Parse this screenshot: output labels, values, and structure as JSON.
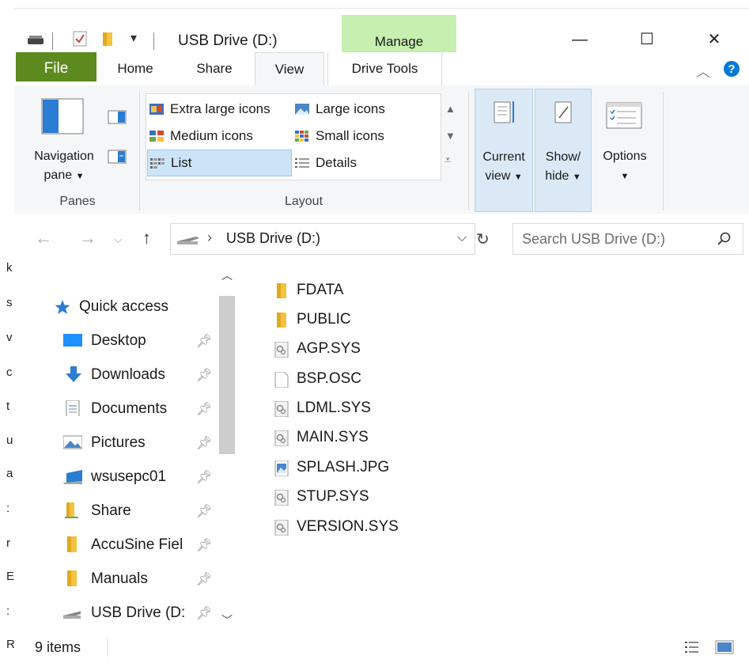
{
  "window": {
    "title": "USB Drive (D:)",
    "context_tab": "Manage",
    "controls": {
      "minimize": "—",
      "maximize": "☐",
      "close": "✕"
    }
  },
  "ribbon_tabs": [
    {
      "label": "File"
    },
    {
      "label": "Home"
    },
    {
      "label": "Share"
    },
    {
      "label": "View"
    },
    {
      "label": "Drive Tools"
    }
  ],
  "ribbon": {
    "panes": {
      "group_label": "Panes",
      "nav_pane_line1": "Navigation",
      "nav_pane_line2": "pane"
    },
    "layout": {
      "group_label": "Layout",
      "options": [
        {
          "label": "Extra large icons"
        },
        {
          "label": "Large icons"
        },
        {
          "label": "Medium icons"
        },
        {
          "label": "Small icons"
        },
        {
          "label": "List",
          "selected": true
        },
        {
          "label": "Details"
        }
      ]
    },
    "current_view": {
      "line1": "Current",
      "line2": "view"
    },
    "show_hide": {
      "line1": "Show/",
      "line2": "hide"
    },
    "options": {
      "label": "Options"
    }
  },
  "address": {
    "breadcrumb": "USB Drive (D:)",
    "search_placeholder": "Search USB Drive (D:)"
  },
  "nav_pane": {
    "quick_access": "Quick access",
    "items": [
      {
        "label": "Desktop",
        "icon": "desktop-icon"
      },
      {
        "label": "Downloads",
        "icon": "downloads-icon"
      },
      {
        "label": "Documents",
        "icon": "documents-icon"
      },
      {
        "label": "Pictures",
        "icon": "pictures-icon"
      },
      {
        "label": "wsusepc01",
        "icon": "network-computer-icon"
      },
      {
        "label": "Share",
        "icon": "share-folder-icon"
      },
      {
        "label": "AccuSine Fiel",
        "icon": "folder-icon"
      },
      {
        "label": "Manuals",
        "icon": "folder-icon"
      },
      {
        "label": "USB Drive (D:",
        "icon": "usb-drive-icon"
      }
    ]
  },
  "files": [
    {
      "name": "FDATA",
      "type": "folder"
    },
    {
      "name": "PUBLIC",
      "type": "folder"
    },
    {
      "name": "AGP.SYS",
      "type": "system"
    },
    {
      "name": "BSP.OSC",
      "type": "file"
    },
    {
      "name": "LDML.SYS",
      "type": "system"
    },
    {
      "name": "MAIN.SYS",
      "type": "system"
    },
    {
      "name": "SPLASH.JPG",
      "type": "image"
    },
    {
      "name": "STUP.SYS",
      "type": "system"
    },
    {
      "name": "VERSION.SYS",
      "type": "system"
    }
  ],
  "status": {
    "item_count": "9 items"
  },
  "colors": {
    "file_tab": "#5d8a1f",
    "manage_tab": "#c6efb0",
    "selected": "#cce4f7",
    "folder": "#f5c242",
    "accent": "#0078d7"
  }
}
